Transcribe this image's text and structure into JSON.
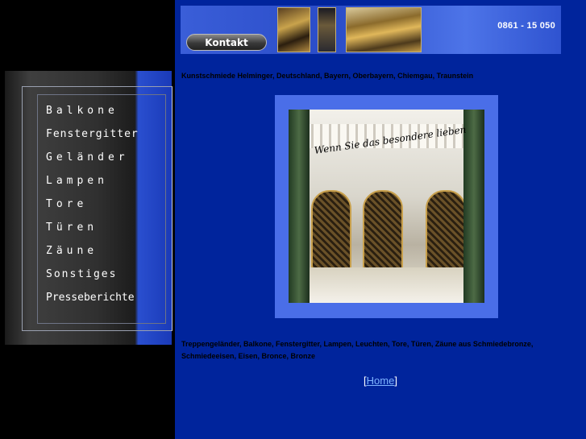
{
  "header": {
    "kontakt_label": "Kontakt",
    "phone": "0861 - 15 050"
  },
  "menu": {
    "items": [
      {
        "label": "Balkone"
      },
      {
        "label": "Fenstergitter"
      },
      {
        "label": "Geländer"
      },
      {
        "label": "Lampen"
      },
      {
        "label": "Tore"
      },
      {
        "label": "Türen"
      },
      {
        "label": "Zäune"
      },
      {
        "label": "Sonstiges"
      },
      {
        "label": "Presseberichte"
      }
    ]
  },
  "main": {
    "subtitle": "Kunstschmiede Helminger, Deutschland, Bayern, Oberbayern, Chiemgau, Traunstein",
    "slogan": "Wenn Sie das besondere lieben",
    "keywords": "Treppengeländer, Balkone, Fenstergitter, Lampen, Leuchten, Tore, Türen, Zäune aus Schmiedebronze, Schmiedeeisen, Eisen, Bronce, Bronze",
    "home_open": "[",
    "home_label": "Home",
    "home_close": "]"
  },
  "colors": {
    "main_background": "#00249c",
    "link": "#7fb4ff"
  }
}
